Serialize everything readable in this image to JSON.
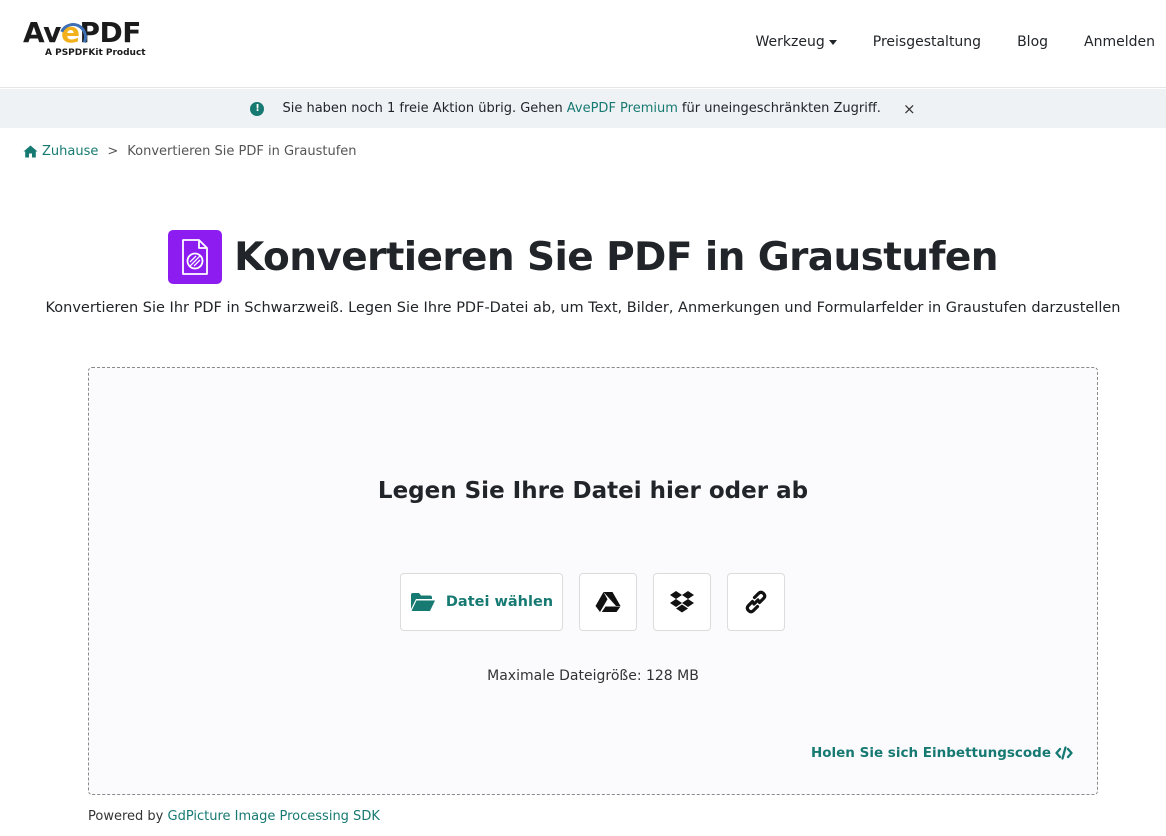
{
  "logo": {
    "text_before": "Av",
    "text_e": "e",
    "text_after": "PDF",
    "tagline": "A PSPDFKit Product"
  },
  "nav": {
    "tools": "Werkzeug",
    "pricing": "Preisgestaltung",
    "blog": "Blog",
    "login": "Anmelden"
  },
  "notice": {
    "icon": "!",
    "text_before": "Sie haben noch 1 freie Aktion übrig. Gehen",
    "link": "AvePDF Premium",
    "text_after": "für uneingeschränkten Zugriff.",
    "close": "×"
  },
  "breadcrumb": {
    "home": "Zuhause",
    "separator": ">",
    "current": "Konvertieren Sie PDF in Graustufen"
  },
  "page": {
    "title": "Konvertieren Sie PDF in Graustufen",
    "subtitle": "Konvertieren Sie Ihr PDF in Schwarzweiß. Legen Sie Ihre PDF-Datei ab, um Text, Bilder, Anmerkungen und Formularfelder in Graustufen darzustellen"
  },
  "dropzone": {
    "title": "Legen Sie Ihre Datei hier oder ab",
    "choose_file": "Datei wählen",
    "max_size": "Maximale Dateigröße: 128 MB",
    "embed": "Holen Sie sich Einbettungscode"
  },
  "footer": {
    "powered_by": "Powered by",
    "sdk_link": "GdPicture Image Processing SDK"
  },
  "colors": {
    "accent": "#177a72",
    "tool_icon": "#8c1cf0",
    "notice_bg": "#eff2f5"
  },
  "icons": [
    "exclamation-icon",
    "home-icon",
    "grayscale-pdf-icon",
    "folder-open-icon",
    "google-drive-icon",
    "dropbox-icon",
    "link-icon",
    "code-icon"
  ]
}
